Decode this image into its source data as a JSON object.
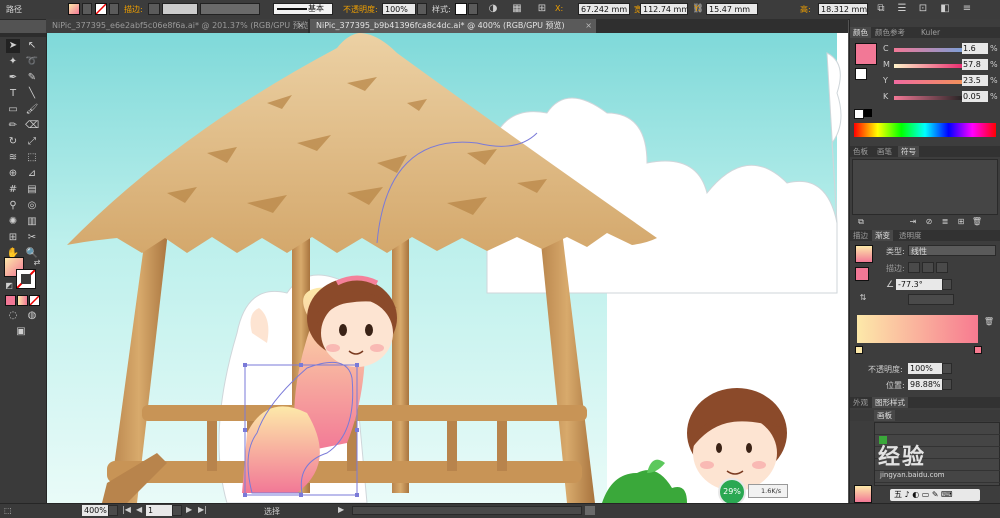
{
  "control_bar": {
    "object_type": "路径",
    "stroke_label": "描边:",
    "brush_name": "基本",
    "opacity_label": "不透明度:",
    "opacity_value": "100%",
    "style_label": "样式:",
    "x_label": "X:",
    "x_value": "67.242 mm",
    "w_label": "宽:",
    "w_value": "112.74 mm",
    "y_label": "Y:",
    "y_value": "15.47 mm",
    "h_label": "高:",
    "h_value": "18.312 mm"
  },
  "tabs": [
    {
      "label": "NiPic_377395_e6e2abf5c06e8f6a.ai* @ 201.37% (RGB/GPU 预览)",
      "active": false
    },
    {
      "label": "NiPic_377395_b9b41396fca8c4dc.ai* @ 400% (RGB/GPU 预览)",
      "active": true
    }
  ],
  "color_panel": {
    "tabs": [
      "颜色",
      "颜色参考",
      "Kuler"
    ],
    "c_label": "C",
    "c_value": "1.6",
    "m_label": "M",
    "m_value": "57.8",
    "y_label": "Y",
    "y_value": "23.5",
    "k_label": "K",
    "k_value": "0.05",
    "unit": "%",
    "fill_color": "#f27896"
  },
  "swatch_panel": {
    "tabs": [
      "色板",
      "画笔",
      "符号"
    ]
  },
  "gradient_panel": {
    "tabs": [
      "描边",
      "渐变",
      "透明度"
    ],
    "type_label": "类型:",
    "type_value": "线性",
    "stroke_label": "描边:",
    "angle_value": "-77.3°",
    "opacity_label": "不透明度:",
    "opacity_value": "100%",
    "position_label": "位置:",
    "position_value": "98.88%",
    "start_color": "#fdeaa5",
    "end_color": "#f77a90"
  },
  "layers_panel": {
    "tabs": [
      "外观",
      "图形样式"
    ],
    "sub_tab": "画板"
  },
  "status_bar": {
    "zoom": "400%",
    "page": "1",
    "tool_name": "选择"
  },
  "performance_badge": {
    "percent": "29%",
    "rate": "1.6K/s"
  },
  "watermark": {
    "text": "经验",
    "sub": "jingyan.baidu.com"
  }
}
